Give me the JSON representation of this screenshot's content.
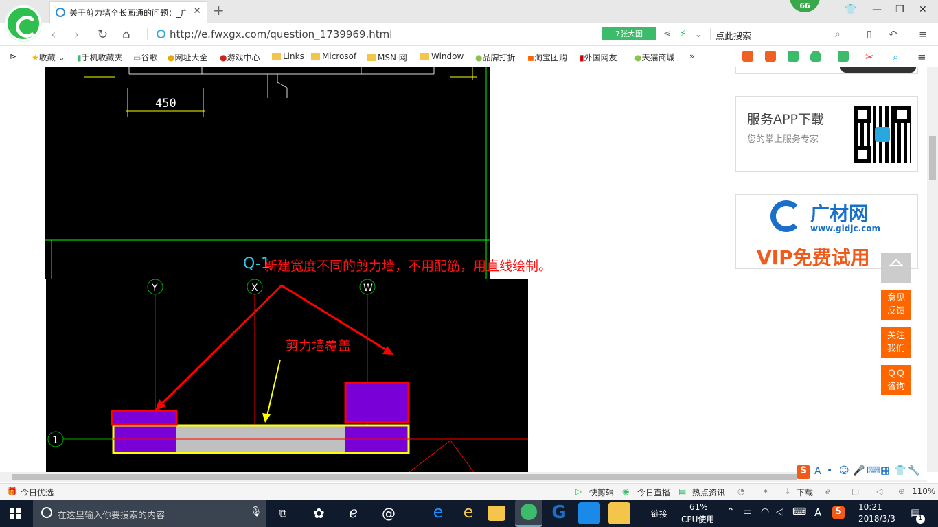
{
  "tab": {
    "title": "关于剪力墙全长画通的问题：_广"
  },
  "window_badge": "66",
  "address": {
    "url": "http://e.fwxgx.com/question_1739969.html",
    "big_image_label": "7张大图",
    "search_placeholder": "点此搜索"
  },
  "bookmarks": [
    "收藏",
    "手机收藏夹",
    "谷歌",
    "网址大全",
    "游戏中心",
    "Links",
    "Microsof",
    "MSN 网",
    "Window",
    "品牌打折",
    "淘宝团购",
    "外国网友",
    "天猫商城"
  ],
  "bookmarks_more": "»",
  "cad": {
    "dimension": "450",
    "wall_label": "Q-1",
    "annotation_main": "新建宽度不同的剪力墙，不用配筋，用直线绘制。",
    "annotation_cover": "剪力墙覆盖",
    "axes": [
      "Y",
      "X",
      "W"
    ],
    "row_axis": "1"
  },
  "sidebar": {
    "app_title": "服务APP下载",
    "app_sub": "您的掌上服务专家",
    "ad_brand": "广材网",
    "ad_url": "www.gldjc.com",
    "ad_slogan": "VIP免费试用",
    "feedback": "意见反馈",
    "follow": "关注我们",
    "qq": "ＱＱ咨询"
  },
  "status": {
    "left": "今日优选",
    "items": [
      "快剪辑",
      "今日直播",
      "热点资讯"
    ],
    "download": "下载",
    "zoom": "110%"
  },
  "taskbar": {
    "search_placeholder": "在这里输入你要搜索的内容",
    "link_label": "链接",
    "cpu_percent": "61%",
    "cpu_label": "CPU使用",
    "time": "10:21",
    "date": "2018/3/3",
    "input_lang": "A",
    "notif_count": "1"
  },
  "colors": {
    "accent_green": "#3cbb6a",
    "orange": "#ff6600",
    "wall_purple": "#7a00d8",
    "cad_red": "#ff0000",
    "cad_yellow": "#ffff00"
  }
}
